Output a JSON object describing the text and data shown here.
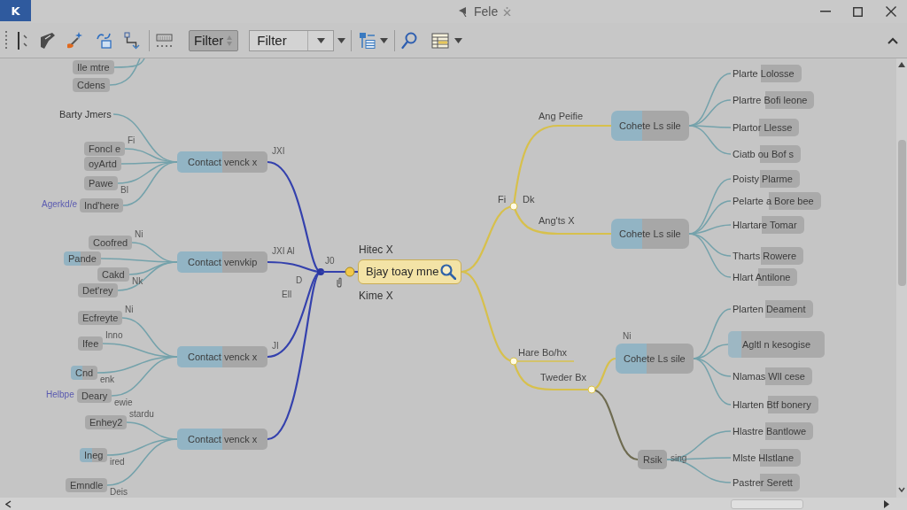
{
  "window": {
    "logo": "K",
    "title": "Fele"
  },
  "toolbar": {
    "filter_button": "Filter",
    "filter_combo": {
      "value": "Filter"
    }
  },
  "mind_map": {
    "top_leaves": [
      {
        "label": "Ile mtre"
      },
      {
        "label": "Cdens"
      }
    ],
    "center": {
      "label": "Bjay toay mne",
      "note_above": "Hitec X",
      "note_below": "Kime X"
    },
    "hub_labels": [
      "J0",
      "D",
      "Ell"
    ],
    "left_branches": [
      {
        "label": "Contact venck x",
        "tag": "JXI",
        "children": [
          {
            "kind": "plain",
            "label": "Barty Jmers"
          },
          {
            "kind": "box",
            "label": "Foncl e",
            "tag": "Fi"
          },
          {
            "kind": "box",
            "label": "oyArtd"
          },
          {
            "kind": "box",
            "label": "Pawe",
            "tag": "Bl"
          },
          {
            "kind": "box",
            "label": "Ind'here",
            "side_label": "Agerkd/e"
          }
        ]
      },
      {
        "label": "Contact venvkip",
        "tag": "JXI Al",
        "children": [
          {
            "kind": "box",
            "label": "Coofred",
            "tag": "Ni"
          },
          {
            "kind": "accent",
            "label": "Pande"
          },
          {
            "kind": "box",
            "label": "Cakd",
            "tag": "Nk"
          },
          {
            "kind": "box",
            "label": "Det'rey"
          }
        ]
      },
      {
        "label": "Contact venck x",
        "tag": "JI",
        "children": [
          {
            "kind": "box",
            "label": "Ecfreyte",
            "tag": "Ni"
          },
          {
            "kind": "box",
            "label": "Ifee",
            "tag": "Inno"
          },
          {
            "kind": "accent",
            "label": "Cnd",
            "tag": "enk"
          },
          {
            "kind": "box",
            "label": "Deary",
            "tag": "ewie",
            "side_label": "Helbpe"
          }
        ]
      },
      {
        "label": "Contact venck x",
        "children": [
          {
            "kind": "box",
            "label": "Enhey2",
            "tag": "stardu"
          },
          {
            "kind": "accent",
            "label": "Ineg",
            "tag": "ired"
          },
          {
            "kind": "box",
            "label": "Emndle",
            "tag": "Deis"
          }
        ]
      }
    ],
    "right_junctions": [
      {
        "labels": [
          "Fi",
          "Dk"
        ],
        "branches": [
          {
            "kind": "split",
            "line_label": "Ang Peifie",
            "label": "Cohete Ls sile",
            "children": [
              {
                "kind": "tail",
                "label": "Plarte Lolosse"
              },
              {
                "kind": "tail",
                "label": "Plartre Bofi leone"
              },
              {
                "kind": "tail",
                "label": "Plartor Llesse"
              },
              {
                "kind": "tail",
                "label": "Ciatb ou Bof s"
              }
            ]
          },
          {
            "kind": "split",
            "line_label": "Ang'ts X",
            "label": "Cohete Ls sile",
            "children": [
              {
                "kind": "tail",
                "label": "Poisty Plarme"
              },
              {
                "kind": "tail",
                "label": "Pelarte a Bore bee"
              },
              {
                "kind": "tail",
                "label": "Hlartare Tomar"
              },
              {
                "kind": "tail",
                "label": "Tharts Rowere"
              },
              {
                "kind": "tail",
                "label": "Hlart Antilone"
              }
            ]
          }
        ]
      },
      {
        "labels": [
          "Hare Bo/hx",
          "Tweder Bx"
        ],
        "branches": [
          {
            "kind": "split",
            "tag": "Ni",
            "label": "Cohete Ls sile",
            "children": [
              {
                "kind": "tail",
                "label": "Plarten Deament"
              },
              {
                "kind": "wide",
                "label": "Agltl n kesogise"
              },
              {
                "kind": "tail",
                "label": "Nlamas Wll cese"
              },
              {
                "kind": "tail",
                "label": "Hlarten Btf bonery"
              }
            ]
          },
          {
            "kind": "gray",
            "tag": "sing",
            "label": "Rsik",
            "children": [
              {
                "kind": "tail",
                "label": "Hlastre Bantlowe"
              },
              {
                "kind": "tail",
                "label": "Mlste Hlstlane"
              },
              {
                "kind": "tail",
                "label": "Pastrer Serett"
              }
            ]
          }
        ]
      }
    ]
  }
}
